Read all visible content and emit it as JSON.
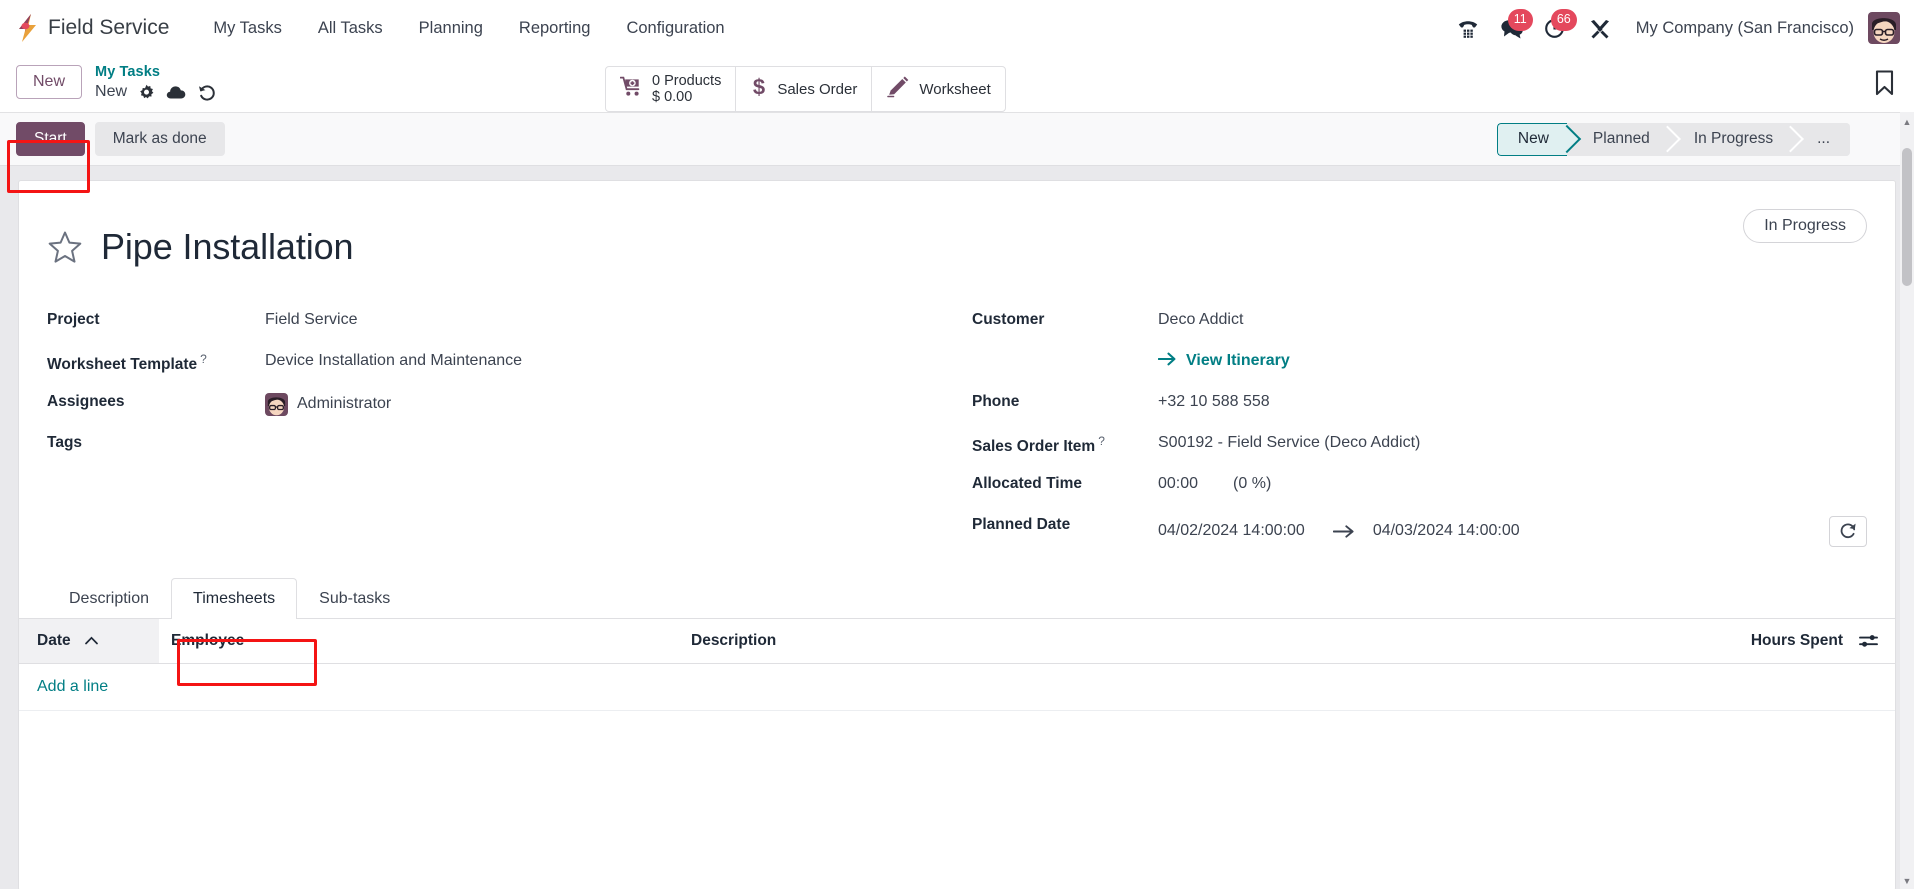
{
  "navbar": {
    "logo_icon": "odoo-bolt-logo",
    "app_name": "Field Service",
    "menu": [
      {
        "label": "My Tasks"
      },
      {
        "label": "All Tasks"
      },
      {
        "label": "Planning"
      },
      {
        "label": "Reporting"
      },
      {
        "label": "Configuration"
      }
    ],
    "icons": {
      "phone": "phone-dialpad-icon",
      "messages": "chat-bubble-icon",
      "activities": "clock-activity-icon",
      "tools": "wrench-tools-icon"
    },
    "badges": {
      "messages_count": "11",
      "activities_count": "66"
    },
    "company": "My Company (San Francisco)",
    "avatar": "user-avatar"
  },
  "control_panel": {
    "new_button": "New",
    "breadcrumb_parent": "My Tasks",
    "breadcrumb_current": "New",
    "actions": {
      "gear": "gear-icon",
      "save": "cloud-upload-save-icon",
      "discard": "undo-discard-icon"
    },
    "stat_buttons": [
      {
        "icon": "cart-plus-icon",
        "line1": "0 Products",
        "line2": "$ 0.00"
      },
      {
        "icon": "dollar-icon",
        "label": "Sales Order"
      },
      {
        "icon": "pencil-ruler-icon",
        "label": "Worksheet"
      }
    ],
    "bookmark_icon": "bookmark-icon"
  },
  "statusbar_row": {
    "start_button": "Start",
    "mark_done_button": "Mark as done",
    "steps": [
      {
        "label": "New",
        "active": true
      },
      {
        "label": "Planned",
        "active": false
      },
      {
        "label": "In Progress",
        "active": false
      },
      {
        "label": "...",
        "active": false
      }
    ]
  },
  "form": {
    "star_icon": "favorite-star-icon",
    "title": "Pipe Installation",
    "stage_badge": "In Progress",
    "left_fields": [
      {
        "label": "Project",
        "value": "Field Service",
        "help": false
      },
      {
        "label": "Worksheet Template",
        "value": "Device Installation and Maintenance",
        "help": true
      },
      {
        "label": "Assignees",
        "value": "Administrator",
        "help": false,
        "avatar": true
      },
      {
        "label": "Tags",
        "value": "",
        "help": false
      }
    ],
    "right_fields": {
      "customer_label": "Customer",
      "customer_value": "Deco Addict",
      "view_itinerary": "View Itinerary",
      "phone_label": "Phone",
      "phone_value": "+32 10 588 558",
      "sales_order_item_label": "Sales Order Item",
      "sales_order_item_value": "S00192 - Field Service (Deco Addict)",
      "allocated_time_label": "Allocated Time",
      "allocated_time_value": "00:00",
      "allocated_time_percent": "(0 %)",
      "planned_date_label": "Planned Date",
      "planned_date_start": "04/02/2024 14:00:00",
      "planned_date_end": "04/03/2024 14:00:00",
      "refresh_icon": "refresh-icon",
      "arrow_icon": "arrow-right-icon"
    }
  },
  "notebook": {
    "tabs": [
      {
        "label": "Description",
        "active": false
      },
      {
        "label": "Timesheets",
        "active": true
      },
      {
        "label": "Sub-tasks",
        "active": false
      }
    ]
  },
  "timesheets_table": {
    "columns": [
      {
        "label": "Date",
        "sorted": true,
        "sort_dir": "asc"
      },
      {
        "label": "Employee",
        "sorted": false
      },
      {
        "label": "Description",
        "sorted": false
      },
      {
        "label": "Hours Spent",
        "sorted": false
      }
    ],
    "rows": [],
    "add_line_label": "Add a line",
    "optional_columns_icon": "sliders-icon",
    "sort_caret_icon": "caret-up-icon"
  },
  "annotations": {
    "highlight_color": "#f41414",
    "targets": [
      "start-button",
      "timesheets-tab"
    ]
  }
}
